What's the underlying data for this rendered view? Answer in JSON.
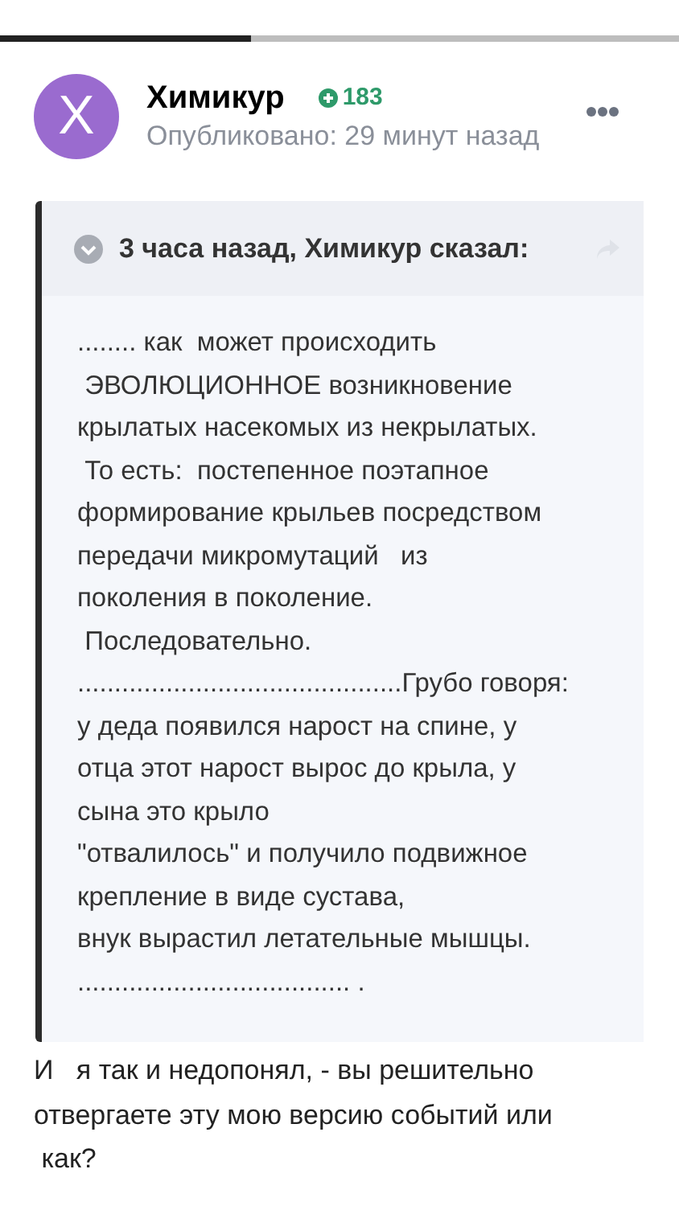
{
  "progress": {
    "level": 0.37
  },
  "post": {
    "author": "Химикур",
    "reputation": "183",
    "published": "Опубликовано: 29 минут назад",
    "avatar_letter": "X"
  },
  "quote": {
    "header": "3 часа назад, Химикур сказал:",
    "lines": [
      "........ как  может происходить",
      " ЭВОЛЮЦИОННОЕ возникновение",
      "крылатых насекомых из некрылатых.",
      " То есть:  постепенное поэтапное",
      "формирование крыльев посредством",
      "передачи микромутаций   из",
      "поколения в поколение.",
      " Последовательно.",
      "............................................Грубо говоря:",
      "у деда появился нарост на спине, у",
      "отца этот нарост вырос до крыла, у",
      "сына это крыло",
      "\"отвалилось\" и получило подвижное",
      "крепление в виде сустава,",
      "внук вырастил летательные мышцы.",
      "..................................... ."
    ]
  },
  "reply_lines": [
    "И   я так и недопонял, - вы решительно",
    "отвергаете эту мою версию событий или",
    " как?"
  ]
}
